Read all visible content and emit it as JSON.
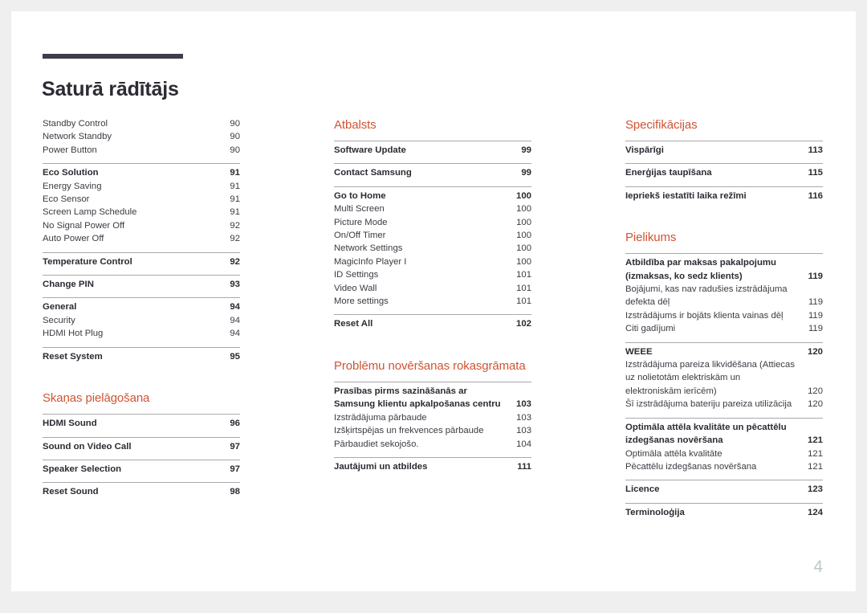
{
  "document": {
    "title": "Saturā rādītājs",
    "folio": "4"
  },
  "columns": [
    {
      "name": "column-1",
      "sections": [
        {
          "heading": null,
          "groups": [
            {
              "ruled": false,
              "entries": [
                {
                  "label": "Standby Control",
                  "page": "90",
                  "bold": false
                },
                {
                  "label": "Network Standby",
                  "page": "90",
                  "bold": false
                },
                {
                  "label": "Power Button",
                  "page": "90",
                  "bold": false
                }
              ]
            },
            {
              "ruled": true,
              "entries": [
                {
                  "label": "Eco Solution",
                  "page": "91",
                  "bold": true
                },
                {
                  "label": "Energy Saving",
                  "page": "91",
                  "bold": false
                },
                {
                  "label": "Eco Sensor",
                  "page": "91",
                  "bold": false
                },
                {
                  "label": "Screen Lamp Schedule",
                  "page": "91",
                  "bold": false
                },
                {
                  "label": "No Signal Power Off",
                  "page": "92",
                  "bold": false
                },
                {
                  "label": "Auto Power Off",
                  "page": "92",
                  "bold": false
                }
              ]
            },
            {
              "ruled": true,
              "entries": [
                {
                  "label": "Temperature Control",
                  "page": "92",
                  "bold": true
                }
              ]
            },
            {
              "ruled": true,
              "entries": [
                {
                  "label": "Change PIN",
                  "page": "93",
                  "bold": true
                }
              ]
            },
            {
              "ruled": true,
              "entries": [
                {
                  "label": "General",
                  "page": "94",
                  "bold": true
                },
                {
                  "label": "Security",
                  "page": "94",
                  "bold": false
                },
                {
                  "label": "HDMI Hot Plug",
                  "page": "94",
                  "bold": false
                }
              ]
            },
            {
              "ruled": true,
              "entries": [
                {
                  "label": "Reset System",
                  "page": "95",
                  "bold": true
                }
              ]
            }
          ]
        },
        {
          "heading": "Skaņas pielāgošana",
          "spacing": "large",
          "groups": [
            {
              "ruled": true,
              "entries": [
                {
                  "label": "HDMI Sound",
                  "page": "96",
                  "bold": true
                }
              ]
            },
            {
              "ruled": true,
              "entries": [
                {
                  "label": "Sound on Video Call",
                  "page": "97",
                  "bold": true
                }
              ]
            },
            {
              "ruled": true,
              "entries": [
                {
                  "label": "Speaker Selection",
                  "page": "97",
                  "bold": true
                }
              ]
            },
            {
              "ruled": true,
              "entries": [
                {
                  "label": "Reset Sound",
                  "page": "98",
                  "bold": true
                }
              ]
            }
          ]
        }
      ]
    },
    {
      "name": "column-2",
      "sections": [
        {
          "heading": "Atbalsts",
          "groups": [
            {
              "ruled": true,
              "entries": [
                {
                  "label": "Software Update",
                  "page": "99",
                  "bold": true
                }
              ]
            },
            {
              "ruled": true,
              "entries": [
                {
                  "label": "Contact Samsung",
                  "page": "99",
                  "bold": true
                }
              ]
            },
            {
              "ruled": true,
              "entries": [
                {
                  "label": "Go to Home",
                  "page": "100",
                  "bold": true
                },
                {
                  "label": "Multi Screen",
                  "page": "100",
                  "bold": false
                },
                {
                  "label": "Picture Mode",
                  "page": "100",
                  "bold": false
                },
                {
                  "label": "On/Off Timer",
                  "page": "100",
                  "bold": false
                },
                {
                  "label": "Network Settings",
                  "page": "100",
                  "bold": false
                },
                {
                  "label": "MagicInfo Player I",
                  "page": "100",
                  "bold": false
                },
                {
                  "label": "ID Settings",
                  "page": "101",
                  "bold": false
                },
                {
                  "label": "Video Wall",
                  "page": "101",
                  "bold": false
                },
                {
                  "label": "More settings",
                  "page": "101",
                  "bold": false
                }
              ]
            },
            {
              "ruled": true,
              "entries": [
                {
                  "label": "Reset All",
                  "page": "102",
                  "bold": true
                }
              ]
            }
          ]
        },
        {
          "heading": "Problēmu novēršanas rokasgrāmata",
          "spacing": "large",
          "groups": [
            {
              "ruled": true,
              "entries": [
                {
                  "label": "Prasības pirms sazināšanās ar Samsung klientu apkalpošanas centru",
                  "page": "103",
                  "bold": true,
                  "multiline": true
                },
                {
                  "label": "Izstrādājuma pārbaude",
                  "page": "103",
                  "bold": false
                },
                {
                  "label": "Izšķirtspējas un frekvences pārbaude",
                  "page": "103",
                  "bold": false
                },
                {
                  "label": "Pārbaudiet sekojošo.",
                  "page": "104",
                  "bold": false
                }
              ]
            },
            {
              "ruled": true,
              "entries": [
                {
                  "label": "Jautājumi un atbildes",
                  "page": "111",
                  "bold": true
                }
              ]
            }
          ]
        }
      ]
    },
    {
      "name": "column-3",
      "sections": [
        {
          "heading": "Specifikācijas",
          "groups": [
            {
              "ruled": true,
              "entries": [
                {
                  "label": "Vispārīgi",
                  "page": "113",
                  "bold": true
                }
              ]
            },
            {
              "ruled": true,
              "entries": [
                {
                  "label": "Enerģijas taupīšana",
                  "page": "115",
                  "bold": true
                }
              ]
            },
            {
              "ruled": true,
              "entries": [
                {
                  "label": "Iepriekš iestatīti laika režīmi",
                  "page": "116",
                  "bold": true
                }
              ]
            }
          ]
        },
        {
          "heading": "Pielikums",
          "spacing": "large",
          "groups": [
            {
              "ruled": true,
              "entries": [
                {
                  "label": "Atbildība par maksas pakalpojumu (izmaksas, ko sedz klients)",
                  "page": "119",
                  "bold": true,
                  "multiline": true
                },
                {
                  "label": "Bojājumi, kas nav radušies izstrādājuma defekta dēļ",
                  "page": "119",
                  "bold": false,
                  "multiline": true
                },
                {
                  "label": "Izstrādājums ir bojāts klienta vainas dēļ",
                  "page": "119",
                  "bold": false
                },
                {
                  "label": "Citi gadījumi",
                  "page": "119",
                  "bold": false
                }
              ]
            },
            {
              "ruled": true,
              "entries": [
                {
                  "label": "WEEE",
                  "page": "120",
                  "bold": true
                },
                {
                  "label": "Izstrādājuma pareiza likvidēšana (Attiecas uz nolietotām elektriskām un elektroniskām ierīcēm)",
                  "page": "120",
                  "bold": false,
                  "multiline": true
                },
                {
                  "label": "Šī izstrādājuma bateriju pareiza utilizācija",
                  "page": "120",
                  "bold": false
                }
              ]
            },
            {
              "ruled": true,
              "entries": [
                {
                  "label": "Optimāla attēla kvalitāte un pēcattēlu izdegšanas novēršana",
                  "page": "121",
                  "bold": true,
                  "multiline": true
                },
                {
                  "label": "Optimāla attēla kvalitāte",
                  "page": "121",
                  "bold": false
                },
                {
                  "label": "Pēcattēlu izdegšanas novēršana",
                  "page": "121",
                  "bold": false
                }
              ]
            },
            {
              "ruled": true,
              "entries": [
                {
                  "label": "Licence",
                  "page": "123",
                  "bold": true
                }
              ]
            },
            {
              "ruled": true,
              "entries": [
                {
                  "label": "Terminoloģija",
                  "page": "124",
                  "bold": true
                }
              ]
            }
          ]
        }
      ]
    }
  ],
  "colors": {
    "accent": "#cf5433",
    "rule": "#3f3d4b",
    "text": "#3b3b43",
    "folio": "#bfc7c9"
  }
}
